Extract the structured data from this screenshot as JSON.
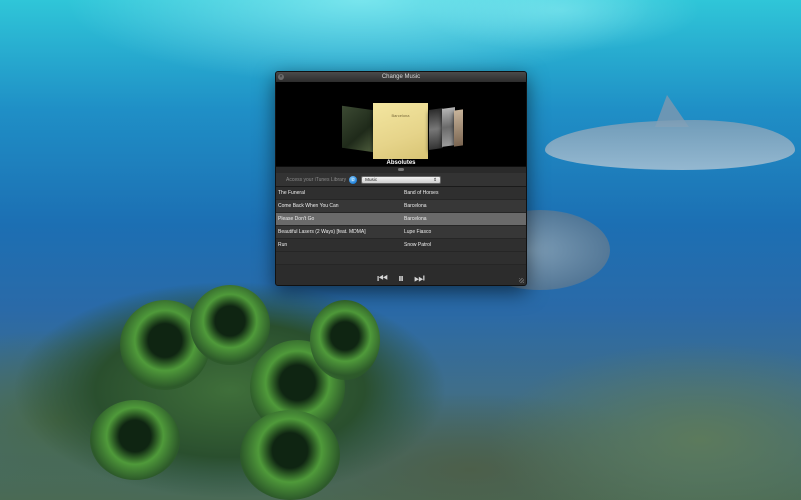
{
  "window": {
    "title": "Change Music"
  },
  "coverflow": {
    "current_album": "Absolutes",
    "center_art_text": "Barcelona"
  },
  "library": {
    "label": "Access your iTunes Library",
    "selected_source": "Music"
  },
  "tracks": [
    {
      "title": "The Funeral",
      "artist": "Band of Horses",
      "selected": false
    },
    {
      "title": "Come Back When You Can",
      "artist": "Barcelona",
      "selected": false
    },
    {
      "title": "Please Don't Go",
      "artist": "Barcelona",
      "selected": true
    },
    {
      "title": "Beautiful Lasers (2 Ways) [feat. MDMA]",
      "artist": "Lupe Fiasco",
      "selected": false
    },
    {
      "title": "Run",
      "artist": "Snow Patrol",
      "selected": false
    }
  ],
  "controls": {
    "previous_icon": "⏮",
    "pause_icon": "⏸",
    "next_icon": "⏭"
  },
  "colors": {
    "selected_row": "#6a6a6a",
    "window_bg": "#1f1f1f"
  }
}
